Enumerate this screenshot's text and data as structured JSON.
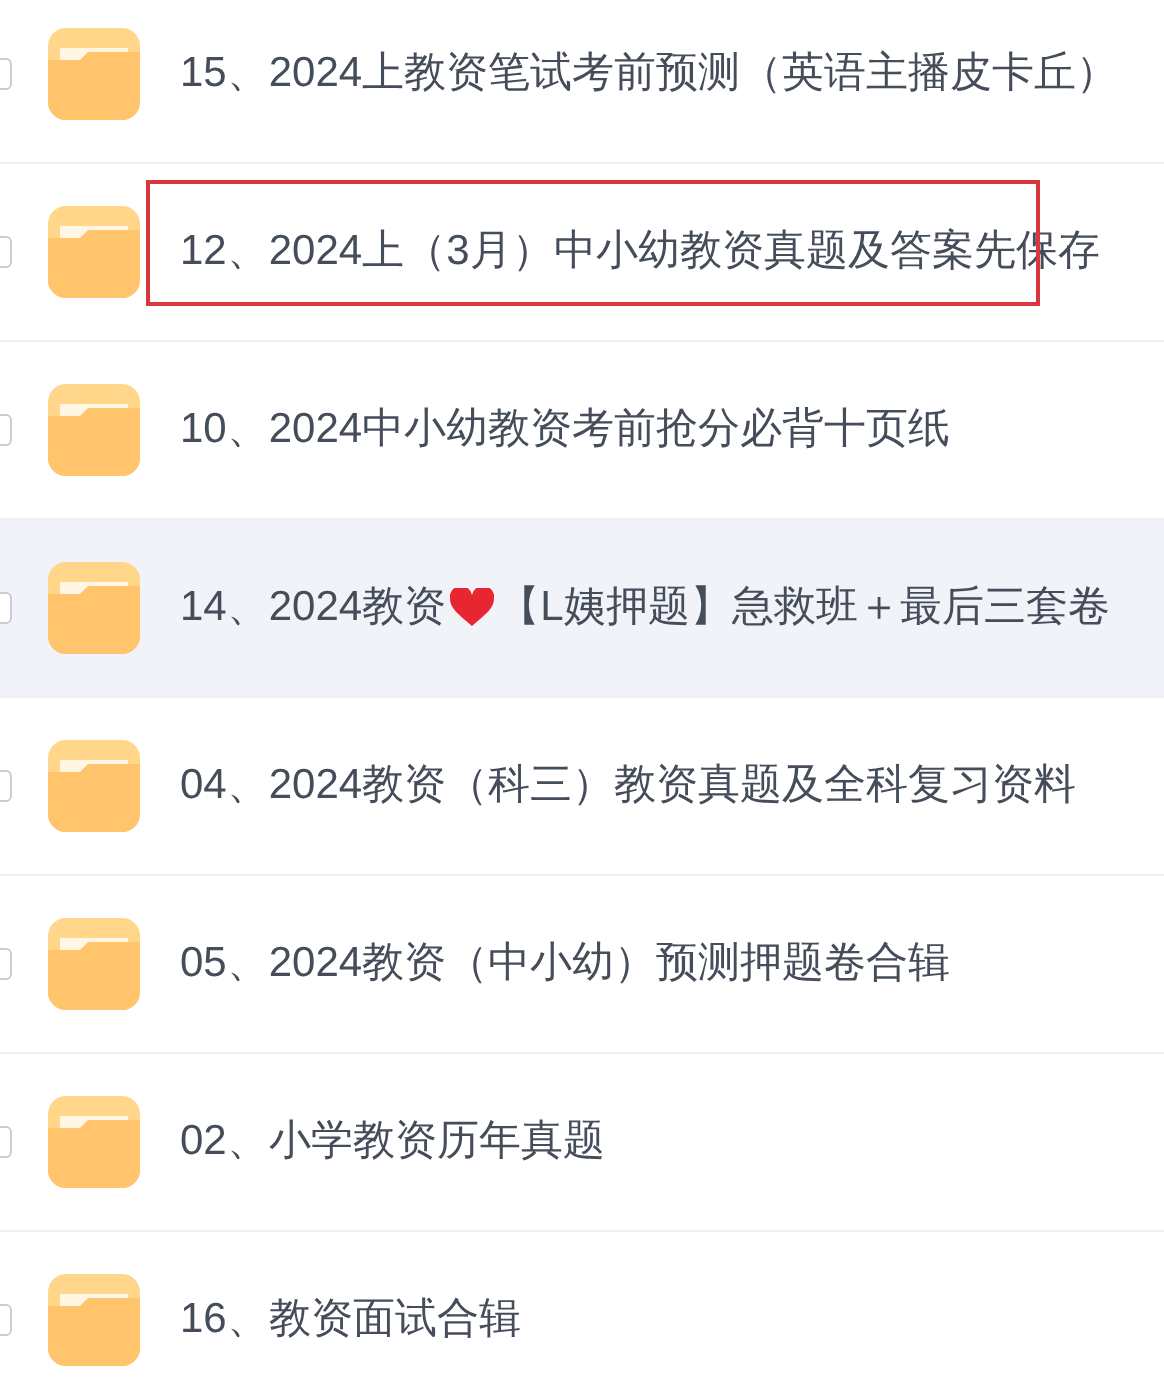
{
  "rows": [
    {
      "name": "15、2024上教资笔试考前预测（英语主播皮卡丘）",
      "checked": false,
      "hovered": false,
      "annotated": false
    },
    {
      "name": "12、2024上（3月）中小幼教资真题及答案先保存",
      "checked": false,
      "hovered": false,
      "annotated": true
    },
    {
      "name": "10、2024中小幼教资考前抢分必背十页纸",
      "checked": false,
      "hovered": false,
      "annotated": false
    },
    {
      "name": "14、2024教资",
      "heart": true,
      "name_after": "【L姨押题】急救班＋最后三套卷",
      "checked": false,
      "hovered": true,
      "annotated": false
    },
    {
      "name": "04、2024教资（科三）教资真题及全科复习资料",
      "checked": false,
      "hovered": false,
      "annotated": false
    },
    {
      "name": "05、2024教资（中小幼）预测押题卷合辑",
      "checked": false,
      "hovered": false,
      "annotated": false
    },
    {
      "name": "02、小学教资历年真题",
      "checked": false,
      "hovered": false,
      "annotated": false
    },
    {
      "name": "16、教资面试合辑",
      "checked": false,
      "hovered": false,
      "annotated": false
    }
  ]
}
